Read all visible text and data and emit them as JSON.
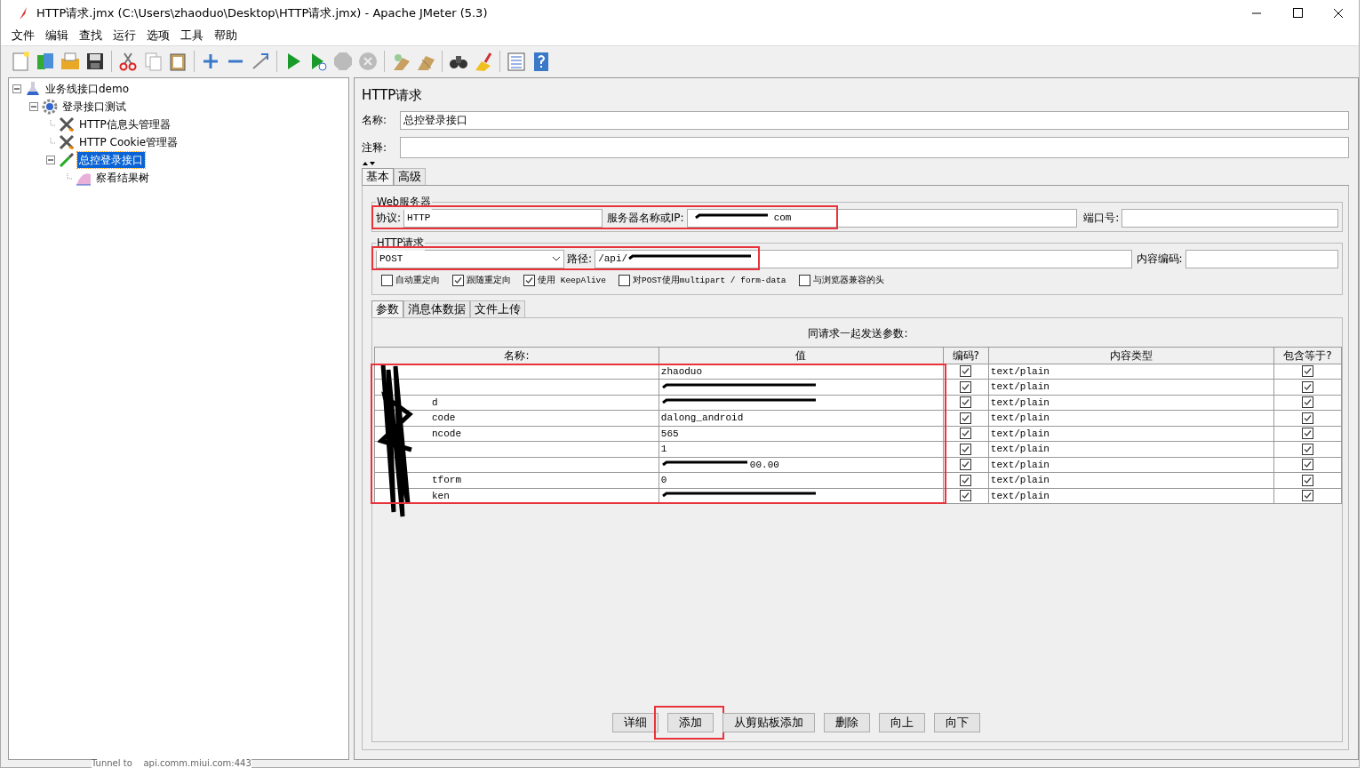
{
  "window": {
    "title": "HTTP请求.jmx (C:\\Users\\zhaoduo\\Desktop\\HTTP请求.jmx) - Apache JMeter (5.3)"
  },
  "menu": [
    "文件",
    "编辑",
    "查找",
    "运行",
    "选项",
    "工具",
    "帮助"
  ],
  "tree": [
    {
      "label": "业务线接口demo",
      "kind": "plan",
      "selected": false,
      "expanded": true,
      "children": [
        {
          "label": "登录接口测试",
          "kind": "group",
          "selected": false,
          "expanded": true,
          "children": [
            {
              "label": "HTTP信息头管理器",
              "kind": "config",
              "selected": false
            },
            {
              "label": "HTTP Cookie管理器",
              "kind": "config",
              "selected": false
            },
            {
              "label": "总控登录接口",
              "kind": "sampler",
              "selected": true,
              "expanded": true,
              "children": [
                {
                  "label": "察看结果树",
                  "kind": "listener",
                  "selected": false
                }
              ]
            }
          ]
        }
      ]
    }
  ],
  "panel": {
    "title": "HTTP请求",
    "name_label": "名称:",
    "name_value": "总控登录接口",
    "comment_label": "注释:",
    "tabs": [
      {
        "label": "基本",
        "selected": true
      },
      {
        "label": "高级",
        "selected": false
      }
    ],
    "web_server": {
      "legend": "Web服务器",
      "highlighted": true,
      "protocol_label": "协议:",
      "protocol_value": "HTTP",
      "server_label": "服务器名称或IP:",
      "server_value": "com",
      "server_redacted": true,
      "port_label": "端口号:"
    },
    "http_request": {
      "legend": "HTTP请求",
      "highlighted": true,
      "method": "POST",
      "path_label": "路径:",
      "path_value": "/api/",
      "path_redacted": true,
      "encoding_label": "内容编码:"
    },
    "options": [
      {
        "label": "自动重定向",
        "checked": false
      },
      {
        "label": "跟随重定向",
        "checked": true
      },
      {
        "label": "使用 KeepAlive",
        "checked": true
      },
      {
        "label": "对POST使用multipart / form-data",
        "checked": false
      },
      {
        "label": "与浏览器兼容的头",
        "checked": false
      }
    ],
    "param_tabs": [
      {
        "label": "参数",
        "selected": true
      },
      {
        "label": "消息体数据",
        "selected": false
      },
      {
        "label": "文件上传",
        "selected": false
      }
    ],
    "params": {
      "caption": "同请求一起发送参数:",
      "highlighted": true,
      "names_redacted": true,
      "columns": [
        "名称:",
        "值",
        "编码?",
        "内容类型",
        "包含等于?"
      ],
      "rows": [
        {
          "name": "",
          "value": "zhaoduo",
          "value_redacted": false,
          "encode": true,
          "content_type": "text/plain",
          "include_equals": true
        },
        {
          "name": "",
          "value": "",
          "value_redacted": true,
          "encode": true,
          "content_type": "text/plain",
          "include_equals": true
        },
        {
          "name": "d",
          "value": "",
          "value_redacted": true,
          "encode": true,
          "content_type": "text/plain",
          "include_equals": true
        },
        {
          "name": "code",
          "value": "dalong_android",
          "value_redacted": false,
          "encode": true,
          "content_type": "text/plain",
          "include_equals": true
        },
        {
          "name": "ncode",
          "value": "565",
          "value_redacted": false,
          "encode": true,
          "content_type": "text/plain",
          "include_equals": true
        },
        {
          "name": "",
          "value": "1",
          "value_redacted": false,
          "encode": true,
          "content_type": "text/plain",
          "include_equals": true
        },
        {
          "name": "",
          "value": "00.00",
          "value_redacted": true,
          "encode": true,
          "content_type": "text/plain",
          "include_equals": true
        },
        {
          "name": "tform",
          "value": "0",
          "value_redacted": false,
          "encode": true,
          "content_type": "text/plain",
          "include_equals": true
        },
        {
          "name": "ken",
          "value": "",
          "value_redacted": true,
          "encode": true,
          "content_type": "text/plain",
          "include_equals": true
        }
      ]
    },
    "buttons": [
      {
        "label": "详细",
        "highlighted": false
      },
      {
        "label": "添加",
        "highlighted": true
      },
      {
        "label": "从剪贴板添加",
        "highlighted": false
      },
      {
        "label": "删除",
        "highlighted": false
      },
      {
        "label": "向上",
        "highlighted": false
      },
      {
        "label": "向下",
        "highlighted": false
      }
    ]
  },
  "status_text": "Tunnel to    api.comm.miui.com:443"
}
